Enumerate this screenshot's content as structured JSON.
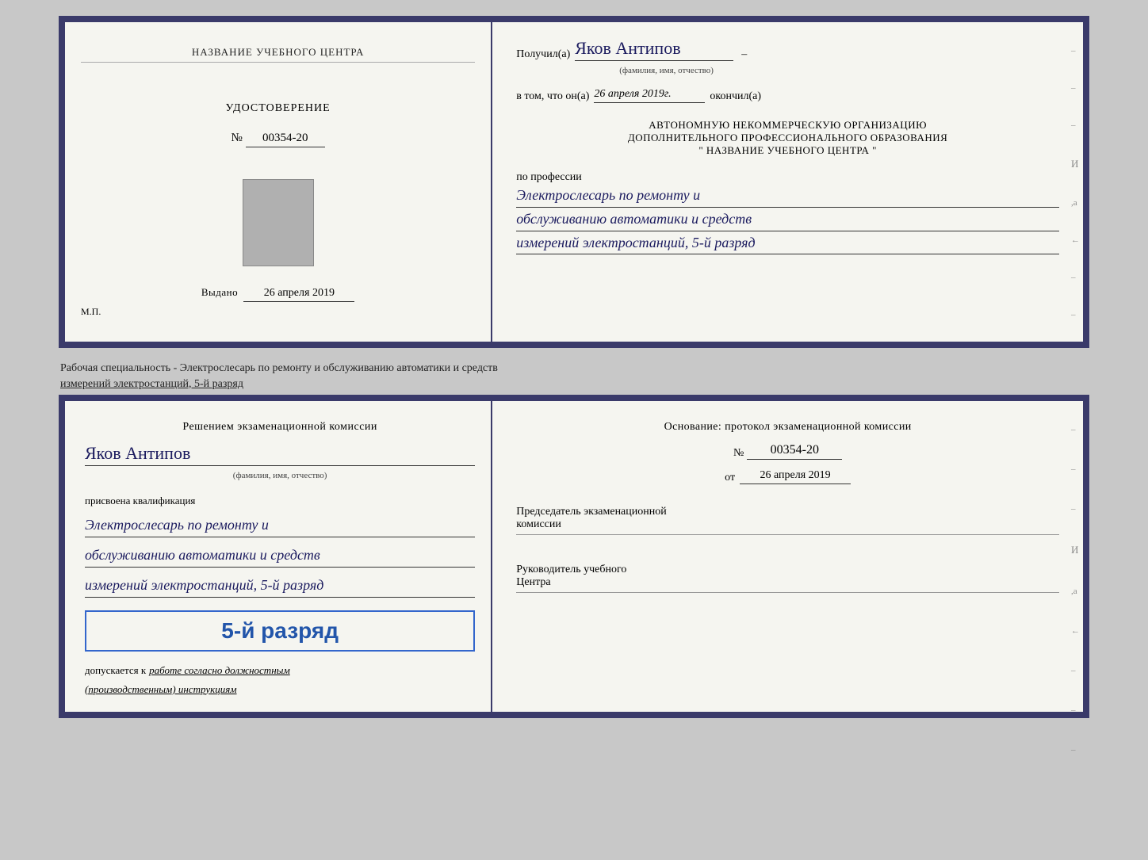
{
  "top_cert": {
    "left": {
      "title": "НАЗВАНИЕ УЧЕБНОГО ЦЕНТРА",
      "udostoverenie_label": "УДОСТОВЕРЕНИЕ",
      "number_prefix": "№",
      "number": "00354-20",
      "issued_label": "Выдано",
      "issued_date": "26 апреля 2019",
      "mp_label": "М.П."
    },
    "right": {
      "received_label": "Получил(а)",
      "recipient_name": "Яков Антипов",
      "fio_note": "(фамилия, имя, отчество)",
      "date_label": "в том, что он(а)",
      "date_value": "26 апреля 2019г.",
      "finished_label": "окончил(а)",
      "org_line1": "АВТОНОМНУЮ НЕКОММЕРЧЕСКУЮ ОРГАНИЗАЦИЮ",
      "org_line2": "ДОПОЛНИТЕЛЬНОГО ПРОФЕССИОНАЛЬНОГО ОБРАЗОВАНИЯ",
      "org_line3": "\"  НАЗВАНИЕ УЧЕБНОГО ЦЕНТРА  \"",
      "profession_label": "по профессии",
      "profession_line1": "Электрослесарь по ремонту и",
      "profession_line2": "обслуживанию автоматики и средств",
      "profession_line3": "измерений электростанций, 5-й разряд"
    }
  },
  "separator": {
    "text_line1": "Рабочая специальность - Электрослесарь по ремонту и обслуживанию автоматики и средств",
    "text_line2": "измерений электростанций, 5-й разряд"
  },
  "bottom_cert": {
    "left": {
      "decision_label": "Решением экзаменационной комиссии",
      "name": "Яков Антипов",
      "fio_note": "(фамилия, имя, отчество)",
      "qualification_label": "присвоена квалификация",
      "qual_line1": "Электрослесарь по ремонту и",
      "qual_line2": "обслуживанию автоматики и средств",
      "qual_line3": "измерений электростанций, 5-й разряд",
      "rank_label": "5-й разряд",
      "allowed_label": "допускается к",
      "allowed_work": "работе согласно должностным",
      "allowed_work2": "(производственным) инструкциям"
    },
    "right": {
      "basis_label": "Основание: протокол экзаменационной комиссии",
      "number_prefix": "№",
      "number": "00354-20",
      "date_prefix": "от",
      "date": "26 апреля 2019",
      "chairman_label": "Председатель экзаменационной",
      "chairman_label2": "комиссии",
      "director_label": "Руководитель учебного",
      "director_label2": "Центра"
    }
  }
}
